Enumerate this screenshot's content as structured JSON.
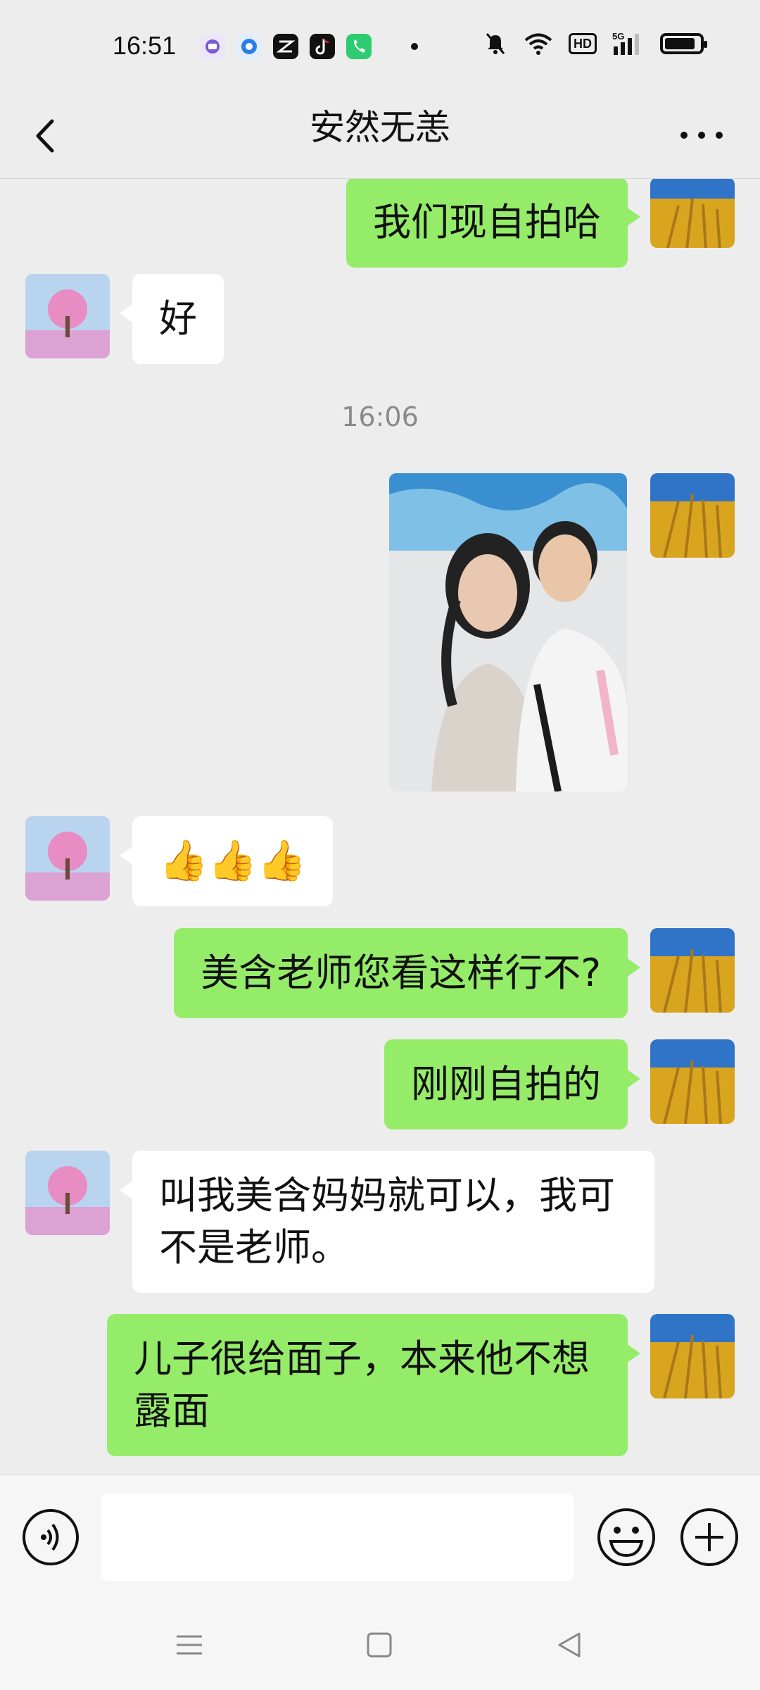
{
  "status_bar": {
    "time": "16:51",
    "app_icons": [
      "purple-app-icon",
      "blue-app-icon",
      "capcut-icon",
      "tiktok-icon",
      "phone-call-icon"
    ],
    "indicators": [
      "mute-icon",
      "wifi-icon",
      "hd-badge",
      "signal-5g-icon",
      "battery-icon"
    ],
    "hd_label": "HD",
    "network_label": "5G"
  },
  "header": {
    "title": "安然无恙",
    "back_icon": "chevron-left-icon",
    "more_icon": "ellipsis-icon"
  },
  "messages": [
    {
      "side": "mine",
      "type": "text",
      "text": "我们现自拍哈"
    },
    {
      "side": "theirs",
      "type": "text",
      "text": "好"
    },
    {
      "type": "timestamp",
      "text": "16:06"
    },
    {
      "side": "mine",
      "type": "image",
      "description": "selfie-photo"
    },
    {
      "side": "theirs",
      "type": "emoji",
      "text": "👍👍👍"
    },
    {
      "side": "mine",
      "type": "text",
      "text": "美含老师您看这样行不?"
    },
    {
      "side": "mine",
      "type": "text",
      "text": "刚刚自拍的"
    },
    {
      "side": "theirs",
      "type": "text",
      "text": "叫我美含妈妈就可以，我可不是老师。"
    },
    {
      "side": "mine",
      "type": "text",
      "text": "儿子很给面子，本来他不想露面"
    }
  ],
  "input_bar": {
    "placeholder": "",
    "voice_icon": "voice-icon",
    "emoji_icon": "emoji-icon",
    "plus_icon": "plus-icon"
  },
  "colors": {
    "background": "#ededed",
    "my_bubble": "#95ec69",
    "their_bubble": "#ffffff",
    "timestamp": "#8a8a8a"
  }
}
